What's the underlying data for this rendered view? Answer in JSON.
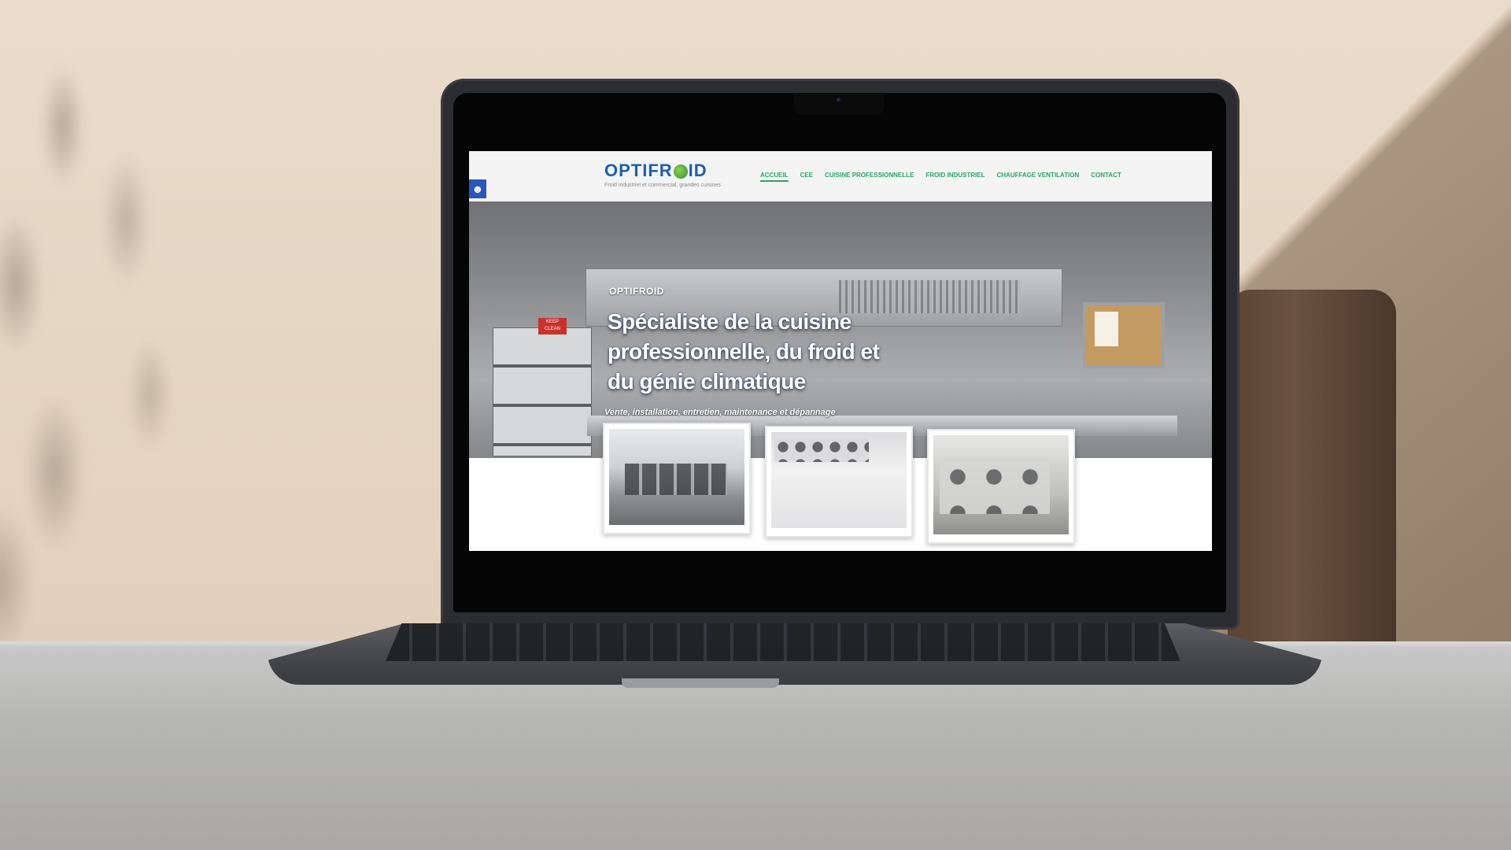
{
  "site": {
    "logo": {
      "text_before": "OPTIFR",
      "text_after": "ID",
      "tagline": "Froid industriel et commercial, grandes cuisines"
    },
    "nav": [
      {
        "label": "ACCUEIL",
        "active": true
      },
      {
        "label": "CEE"
      },
      {
        "label": "CUISINE PROFESSIONNELLE"
      },
      {
        "label": "FROID INDUSTRIEL"
      },
      {
        "label": "CHAUFFAGE VENTILATION"
      },
      {
        "label": "CONTACT"
      }
    ],
    "hero": {
      "brand": "OPTIFROID",
      "title": "Spécialiste de la cuisine professionnelle, du froid et du génie climatique",
      "subtitle": "Vente, installation, entretien, maintenance et dépannage",
      "sign": "KEEP CLEAN"
    },
    "cards": [
      {
        "icon": "kitchen-photo-icon"
      },
      {
        "icon": "cold-room-photo-icon"
      },
      {
        "icon": "air-conditioning-photo-icon"
      }
    ],
    "accessibility_icon": "accessibility-icon"
  },
  "colors": {
    "nav": "#2aa36b",
    "logo": "#1f5fa8",
    "accessibility": "#2a56b8"
  }
}
